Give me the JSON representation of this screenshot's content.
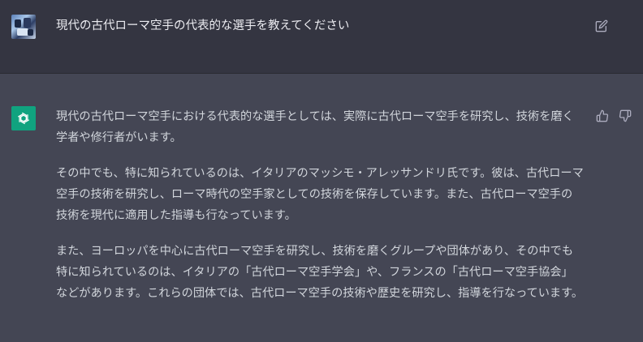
{
  "user_message": {
    "text": "現代の古代ローマ空手の代表的な選手を教えてください"
  },
  "assistant_message": {
    "paragraphs": [
      "現代の古代ローマ空手における代表的な選手としては、実際に古代ローマ空手を研究し、技術を磨く学者や修行者がいます。",
      "その中でも、特に知られているのは、イタリアのマッシモ・アレッサンドリ氏です。彼は、古代ローマ空手の技術を研究し、ローマ時代の空手家としての技術を保存しています。また、古代ローマ空手の技術を現代に適用した指導も行なっています。",
      "また、ヨーロッパを中心に古代ローマ空手を研究し、技術を磨くグループや団体があり、その中でも特に知られているのは、イタリアの「古代ローマ空手学会」や、フランスの「古代ローマ空手協会」などがあります。これらの団体では、古代ローマ空手の技術や歴史を研究し、指導を行なっています。"
    ]
  },
  "colors": {
    "user_row_bg": "#343541",
    "assistant_row_bg": "#444654",
    "assistant_avatar_bg": "#10a37f",
    "text_primary": "#ececf1",
    "text_secondary": "#d1d5db",
    "icon_gray": "#acacbe"
  },
  "icons": {
    "edit": "edit-icon",
    "assistant_avatar": "openai-logo-icon",
    "thumbs_up": "thumbs-up-icon",
    "thumbs_down": "thumbs-down-icon"
  }
}
